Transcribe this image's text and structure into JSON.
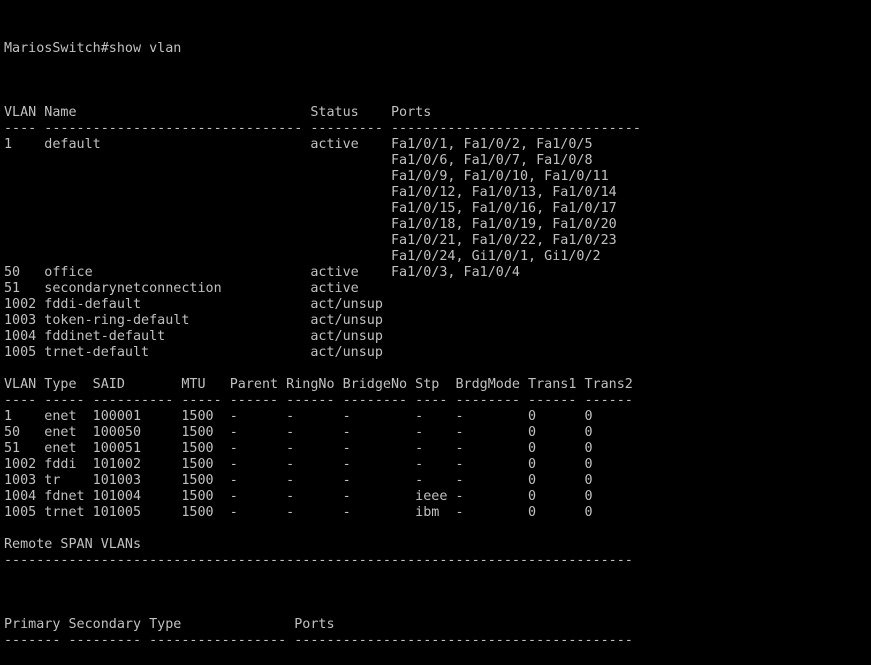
{
  "terminal": {
    "prompt": "MariosSwitch#show vlan",
    "lines": [
      "",
      "VLAN Name                             Status    Ports",
      "---- -------------------------------- --------- -------------------------------",
      "1    default                          active    Fa1/0/1, Fa1/0/2, Fa1/0/5",
      "                                                Fa1/0/6, Fa1/0/7, Fa1/0/8",
      "                                                Fa1/0/9, Fa1/0/10, Fa1/0/11",
      "                                                Fa1/0/12, Fa1/0/13, Fa1/0/14",
      "                                                Fa1/0/15, Fa1/0/16, Fa1/0/17",
      "                                                Fa1/0/18, Fa1/0/19, Fa1/0/20",
      "                                                Fa1/0/21, Fa1/0/22, Fa1/0/23",
      "                                                Fa1/0/24, Gi1/0/1, Gi1/0/2",
      "50   office                           active    Fa1/0/3, Fa1/0/4",
      "51   secondarynetconnection           active",
      "1002 fddi-default                     act/unsup",
      "1003 token-ring-default               act/unsup",
      "1004 fddinet-default                  act/unsup",
      "1005 trnet-default                    act/unsup",
      "",
      "VLAN Type  SAID       MTU   Parent RingNo BridgeNo Stp  BrdgMode Trans1 Trans2",
      "---- ----- ---------- ----- ------ ------ -------- ---- -------- ------ ------",
      "1    enet  100001     1500  -      -      -        -    -        0      0",
      "50   enet  100050     1500  -      -      -        -    -        0      0",
      "51   enet  100051     1500  -      -      -        -    -        0      0",
      "1002 fddi  101002     1500  -      -      -        -    -        0      0",
      "1003 tr    101003     1500  -      -      -        -    -        0      0",
      "1004 fdnet 101004     1500  -      -      -        ieee -        0      0",
      "1005 trnet 101005     1500  -      -      -        ibm  -        0      0",
      "",
      "Remote SPAN VLANs",
      "------------------------------------------------------------------------------",
      "",
      "",
      "",
      "Primary Secondary Type              Ports",
      "------- --------- ----------------- ------------------------------------------"
    ]
  }
}
